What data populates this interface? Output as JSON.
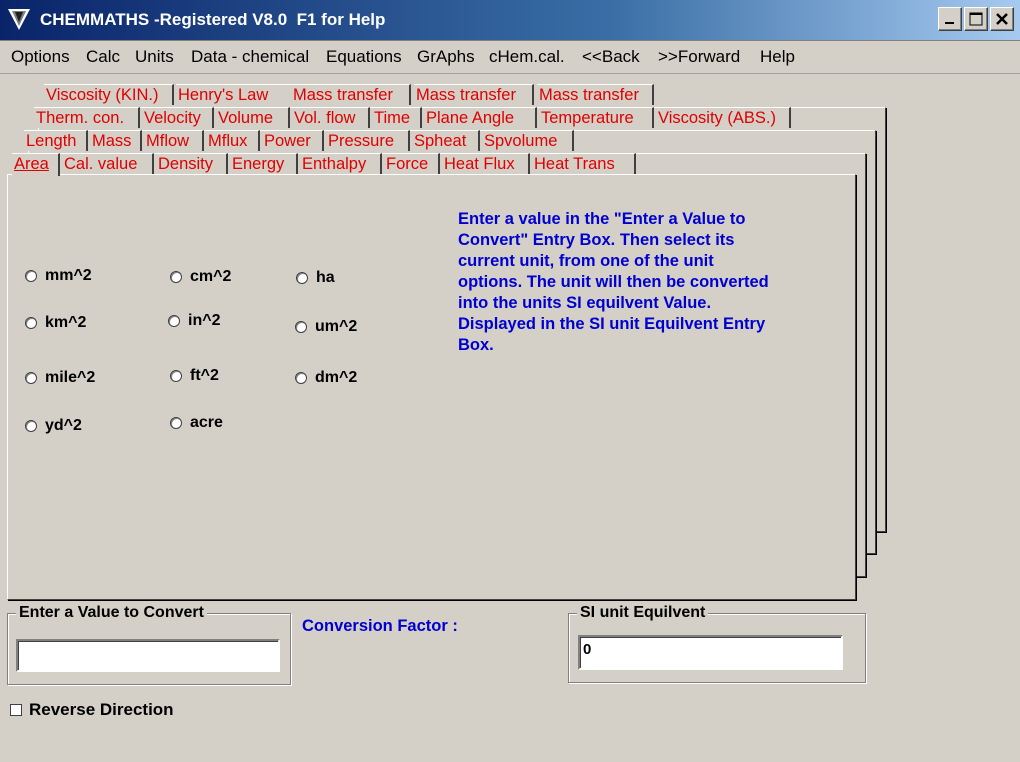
{
  "window": {
    "title": "CHEMMATHS -Registered V8.0  F1 for Help",
    "icon": "triangle-app-icon",
    "controls": [
      "minimize-icon",
      "maximize-icon",
      "close-icon"
    ]
  },
  "menu": [
    {
      "label": "Options"
    },
    {
      "label": "Calc"
    },
    {
      "label": "Units"
    },
    {
      "label": "Data - chemical"
    },
    {
      "label": "Equations"
    },
    {
      "label": "GrAphs"
    },
    {
      "label": "cHem.cal."
    },
    {
      "label": "<<Back"
    },
    {
      "label": ">>Forward"
    },
    {
      "label": "Help"
    }
  ],
  "tab_rows": [
    [
      "Viscosity (KIN.)",
      "Henry's Law",
      "Mass transfer",
      "Mass transfer",
      "Mass transfer"
    ],
    [
      "Therm. con.",
      "Velocity",
      "Volume",
      "Vol. flow",
      "Time",
      "Plane Angle",
      "Temperature",
      "Viscosity (ABS.)"
    ],
    [
      "Length",
      "Mass",
      "Mflow",
      "Mflux",
      "Power",
      "Pressure",
      "Spheat",
      "Spvolume"
    ],
    [
      "Area",
      "Cal. value",
      "Density",
      "Energy",
      "Enthalpy",
      "Force",
      "Heat Flux",
      "Heat Trans"
    ]
  ],
  "active_tab": "Area",
  "units": [
    "mm^2",
    "cm^2",
    "ha",
    "km^2",
    "in^2",
    "um^2",
    "mile^2",
    "ft^2",
    "dm^2",
    "yd^2",
    "acre"
  ],
  "instructions": "Enter a value in the \"Enter a Value to Convert\" Entry Box.  Then select its current unit, from one of the unit options.  The unit will then be converted into the units SI equilvent Value. Displayed in the SI unit Equilvent Entry Box.",
  "input_group": {
    "title": "Enter a Value to Convert",
    "value": ""
  },
  "conversion_label": "Conversion Factor :",
  "output_group": {
    "title": "SI  unit  Equilvent",
    "value": "0"
  },
  "reverse": {
    "label": "Reverse Direction",
    "checked": false
  },
  "colors": {
    "tab_text": "#e00000",
    "info_text": "#0000d0",
    "face": "#d4d0c8"
  }
}
